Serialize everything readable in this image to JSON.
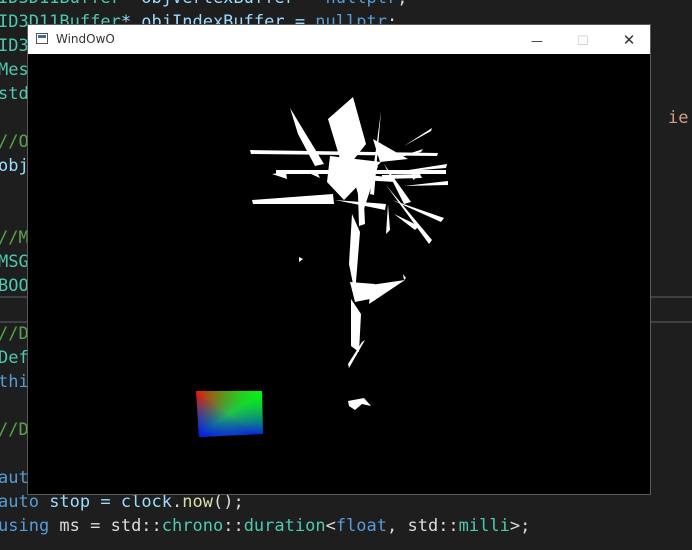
{
  "editor": {
    "lines": [
      {
        "segments": [
          {
            "text": "ID3D11Buffer",
            "color": "#4ec9b0"
          },
          {
            "text": "* objVertexBuffer = ",
            "color": "#9cdcfe"
          },
          {
            "text": "nullptr",
            "color": "#569cd6"
          },
          {
            "text": ";",
            "color": "#dcdcdc"
          }
        ]
      },
      {
        "segments": [
          {
            "text": "ID3D11Buffer",
            "color": "#4ec9b0"
          },
          {
            "text": "* objIndexBuffer = ",
            "color": "#9cdcfe"
          },
          {
            "text": "nullptr",
            "color": "#569cd6"
          },
          {
            "text": ";",
            "color": "#dcdcdc"
          }
        ]
      },
      {
        "segments": [
          {
            "text": "ID3",
            "color": "#4ec9b0"
          }
        ]
      },
      {
        "segments": [
          {
            "text": "Mes",
            "color": "#4ec9b0"
          }
        ]
      },
      {
        "segments": [
          {
            "text": "std",
            "color": "#4ec9b0"
          }
        ]
      },
      {
        "segments": []
      },
      {
        "segments": [
          {
            "text": "//O",
            "color": "#57a64a"
          }
        ]
      },
      {
        "segments": [
          {
            "text": "obj",
            "color": "#9cdcfe"
          }
        ]
      },
      {
        "segments": []
      },
      {
        "segments": []
      },
      {
        "segments": [
          {
            "text": "//M",
            "color": "#57a64a"
          }
        ]
      },
      {
        "segments": [
          {
            "text": "MSG",
            "color": "#4ec9b0"
          }
        ]
      },
      {
        "segments": [
          {
            "text": "BOO",
            "color": "#4ec9b0"
          }
        ]
      },
      {
        "segments": []
      },
      {
        "segments": [
          {
            "text": "//D",
            "color": "#57a64a"
          }
        ]
      },
      {
        "segments": [
          {
            "text": "Def",
            "color": "#4ec9b0"
          }
        ]
      },
      {
        "segments": [
          {
            "text": "thi",
            "color": "#569cd6"
          }
        ]
      },
      {
        "segments": []
      },
      {
        "segments": [
          {
            "text": "//D",
            "color": "#57a64a"
          }
        ]
      },
      {
        "segments": []
      },
      {
        "segments": [
          {
            "text": "aut",
            "color": "#569cd6"
          }
        ]
      },
      {
        "segments": [
          {
            "text": "auto",
            "color": "#569cd6"
          },
          {
            "text": " stop = ",
            "color": "#9cdcfe"
          },
          {
            "text": "clock",
            "color": "#9cdcfe"
          },
          {
            "text": ".",
            "color": "#dcdcdc"
          },
          {
            "text": "now",
            "color": "#dcdcaa"
          },
          {
            "text": "();",
            "color": "#dcdcdc"
          }
        ]
      },
      {
        "segments": [
          {
            "text": "using",
            "color": "#569cd6"
          },
          {
            "text": " ms = std::",
            "color": "#dcdcdc"
          },
          {
            "text": "chrono",
            "color": "#4ec9b0"
          },
          {
            "text": "::",
            "color": "#dcdcdc"
          },
          {
            "text": "duration",
            "color": "#4ec9b0"
          },
          {
            "text": "<",
            "color": "#dcdcdc"
          },
          {
            "text": "float",
            "color": "#569cd6"
          },
          {
            "text": ", std::",
            "color": "#dcdcdc"
          },
          {
            "text": "milli",
            "color": "#4ec9b0"
          },
          {
            "text": ">;",
            "color": "#dcdcdc"
          }
        ]
      }
    ],
    "right_fragment": {
      "text": "ie.ob",
      "color": "#d69d85"
    }
  },
  "window": {
    "title": "WindOwO",
    "buttons": {
      "minimize": "—",
      "maximize": "☐",
      "close": "✕"
    },
    "scene": {
      "background": "#000000",
      "mesh_color": "#ffffff",
      "gradient_quad_colors": [
        "#ff0000",
        "#00ff00",
        "#0000ff",
        "#ff0000"
      ]
    }
  }
}
